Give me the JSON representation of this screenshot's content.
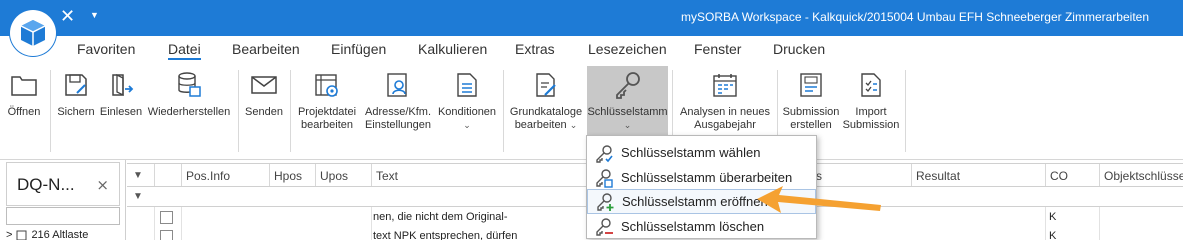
{
  "app": {
    "window_title": "mySORBA Workspace - Kalkquick/2015004 Umbau EFH Schneeberger Zimmerarbeiten",
    "close_glyph": "✕",
    "dropdown_glyph": "▼"
  },
  "menu": {
    "items": [
      "Favoriten",
      "Datei",
      "Bearbeiten",
      "Einfügen",
      "Kalkulieren",
      "Extras",
      "Lesezeichen",
      "Fenster",
      "Drucken"
    ],
    "active_index": 1
  },
  "ribbon": {
    "buttons": [
      {
        "label": "Öffnen",
        "icon": "folder-icon"
      },
      {
        "label": "Sichern",
        "icon": "save-icon"
      },
      {
        "label": "Einlesen",
        "icon": "import-icon"
      },
      {
        "label": "Wiederherstellen",
        "icon": "database-restore-icon"
      },
      {
        "label": "Senden",
        "icon": "mail-icon"
      },
      {
        "label": "Projektdatei\nbearbeiten",
        "icon": "project-settings-icon"
      },
      {
        "label": "Adresse/Kfm.\nEinstellungen",
        "icon": "address-icon"
      },
      {
        "label": "Konditionen",
        "icon": "conditions-icon"
      },
      {
        "label": "Grundkataloge\nbearbeiten",
        "icon": "catalog-edit-icon"
      },
      {
        "label": "Schlüsselstamm",
        "icon": "key-icon"
      },
      {
        "label": "Analysen in neues\nAusgabejahr",
        "icon": "calendar-analysis-icon"
      },
      {
        "label": "Submission\nerstellen",
        "icon": "submission-create-icon"
      },
      {
        "label": "Import\nSubmission",
        "icon": "submission-import-icon"
      }
    ],
    "chevron": "⌄"
  },
  "left_panel": {
    "tab_label": "DQ-N...",
    "tab_close": "×",
    "search_value": "",
    "tree_expander": ">",
    "tree_item": "216 Altlaste"
  },
  "grid": {
    "columns": [
      "Pos.Info",
      "Hpos",
      "Upos",
      "Text",
      "s",
      "Resultat",
      "CO",
      "Objektschlüssel"
    ],
    "funnel": "▼",
    "rows": [
      {
        "text": "nen, die nicht dem Original-",
        "co": "K"
      },
      {
        "text": "text NPK entsprechen, dürfen",
        "co": "K"
      }
    ]
  },
  "dropdown": {
    "items": [
      {
        "label": "Schlüsselstamm wählen",
        "icon": "key-select-icon"
      },
      {
        "label": "Schlüsselstamm überarbeiten",
        "icon": "key-edit-icon"
      },
      {
        "label": "Schlüsselstamm eröffnen",
        "icon": "key-new-icon"
      },
      {
        "label": "Schlüsselstamm löschen",
        "icon": "key-delete-icon"
      }
    ],
    "highlighted_index": 2
  },
  "colors": {
    "title_bar": "#1e7bd6",
    "accent": "#1e7bd6",
    "arrow": "#f5a131",
    "pressed": "#c8c8c8"
  }
}
